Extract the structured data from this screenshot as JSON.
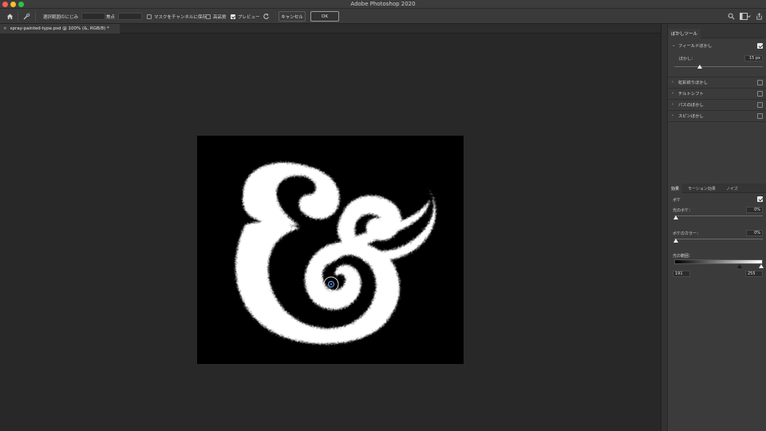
{
  "app": {
    "title": "Adobe Photoshop 2020"
  },
  "options_bar": {
    "feather_selection_label": "選択範囲のにじみ",
    "focus_label": "焦点",
    "save_mask_label": "マスクをチャンネルに保存",
    "high_quality_label": "高品質",
    "preview_label": "プレビュー",
    "preview_checked": true,
    "cancel_label": "キャンセル",
    "ok_label": "OK"
  },
  "document": {
    "tab_label": "spray-painted-type.psd @ 100% (&, RGB/8) *",
    "close_glyph": "×",
    "canvas_glyph": "&",
    "canvas_bg": "#000000",
    "glyph_color": "#ffffff"
  },
  "blur_tools": {
    "panel_tab": "ぼかしツール",
    "items": [
      {
        "label": "フィールドぼかし",
        "expanded": true,
        "checked": true
      },
      {
        "label": "虹彩絞りぼかし",
        "expanded": false,
        "checked": false
      },
      {
        "label": "チルトシフト",
        "expanded": false,
        "checked": false
      },
      {
        "label": "パスのぼかし",
        "expanded": false,
        "checked": false
      },
      {
        "label": "スピンぼかし",
        "expanded": false,
        "checked": false
      }
    ],
    "blur_label": "ぼかし：",
    "blur_value": "15 px",
    "blur_level": 0.25
  },
  "effects": {
    "tabs": [
      "効果",
      "モーション効果",
      "ノイズ"
    ],
    "bokeh_label": "ボケ",
    "bokeh_checked": true,
    "light_bokeh_label": "光のボケ：",
    "light_bokeh_value": "0%",
    "bokeh_color_label": "ボケのカラー：",
    "bokeh_color_value": "0%",
    "light_range_label": "光の範囲：",
    "light_range_min": "191",
    "light_range_max": "255"
  },
  "colors": {
    "accent": "#e8e8e8",
    "panel_bg": "#3b3b3b",
    "workspace_bg": "#282828"
  }
}
